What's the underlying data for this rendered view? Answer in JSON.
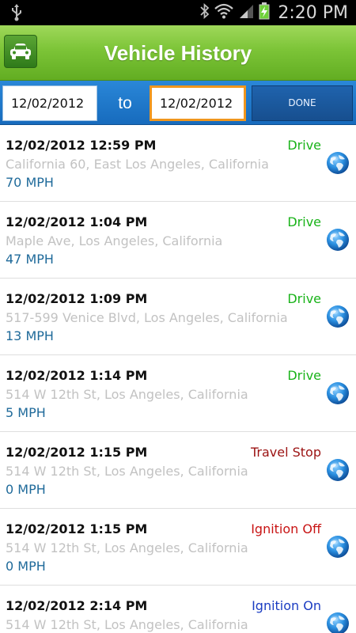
{
  "status_bar": {
    "time": "2:20 PM",
    "icons": [
      "usb-icon",
      "bluetooth-icon",
      "wifi-icon",
      "signal-icon",
      "battery-charging-icon"
    ]
  },
  "header": {
    "title": "Vehicle History",
    "icon": "car-icon"
  },
  "date_range": {
    "from_value": "12/02/2012",
    "separator": "to",
    "to_value": "12/02/2012",
    "done_label": "DONE",
    "accent_color": "#f0961e"
  },
  "colors": {
    "drive": "#19b319",
    "travel_stop": "#9b1212",
    "ignition_off": "#c81414",
    "ignition_on": "#1a3cc2",
    "speed": "#1f6a9a",
    "address": "#c2c2c2"
  },
  "history": [
    {
      "timestamp": "12/02/2012 12:59 PM",
      "status": "Drive",
      "status_kind": "drive",
      "address": "California 60, East Los Angeles, California",
      "speed": "70 MPH"
    },
    {
      "timestamp": "12/02/2012 1:04 PM",
      "status": "Drive",
      "status_kind": "drive",
      "address": "Maple Ave, Los Angeles, California",
      "speed": "47 MPH"
    },
    {
      "timestamp": "12/02/2012 1:09 PM",
      "status": "Drive",
      "status_kind": "drive",
      "address": "517-599 Venice Blvd, Los Angeles, California",
      "speed": "13 MPH"
    },
    {
      "timestamp": "12/02/2012 1:14 PM",
      "status": "Drive",
      "status_kind": "drive",
      "address": "514 W 12th St, Los Angeles, California",
      "speed": "5 MPH"
    },
    {
      "timestamp": "12/02/2012 1:15 PM",
      "status": "Travel Stop",
      "status_kind": "travel_stop",
      "address": "514 W 12th St, Los Angeles, California",
      "speed": "0 MPH"
    },
    {
      "timestamp": "12/02/2012 1:15 PM",
      "status": "Ignition Off",
      "status_kind": "ignition_off",
      "address": "514 W 12th St, Los Angeles, California",
      "speed": "0 MPH"
    },
    {
      "timestamp": "12/02/2012 2:14 PM",
      "status": "Ignition On",
      "status_kind": "ignition_on",
      "address": "514 W 12th St, Los Angeles, California",
      "speed": ""
    }
  ]
}
